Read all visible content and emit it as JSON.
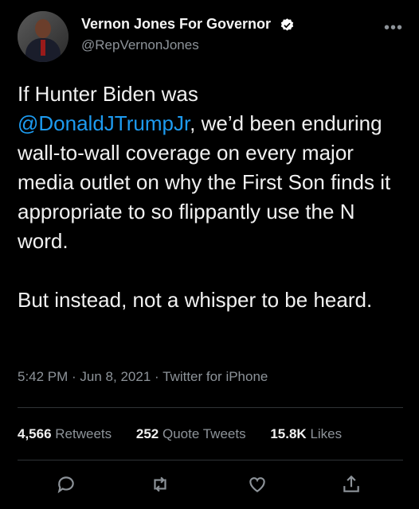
{
  "account": {
    "name": "Vernon Jones For Governor",
    "handle": "@RepVernonJones"
  },
  "more_label": "•••",
  "tweet": {
    "line1": "If Hunter Biden was",
    "mention": "@DonaldJTrumpJr",
    "after_mention": ", we’d been",
    "rest": "enduring wall-to-wall coverage on every major media outlet on why the First Son finds it appropriate to so flippantly use the N word.",
    "para2": "But instead, not a whisper to be heard."
  },
  "meta": {
    "time": "5:42 PM",
    "sep1": " · ",
    "date": "Jun 8, 2021",
    "sep2": " · ",
    "client": "Twitter for iPhone"
  },
  "stats": {
    "retweets_count": "4,566",
    "retweets_label": "Retweets",
    "quotes_count": "252",
    "quotes_label": "Quote Tweets",
    "likes_count": "15.8K",
    "likes_label": "Likes"
  },
  "colors": {
    "background": "#000000",
    "text": "#f1f1f1",
    "secondary": "#8d9399",
    "link": "#1d9bf0",
    "verified": "#ffffff"
  },
  "icons": [
    "reply-icon",
    "retweet-icon",
    "like-icon",
    "share-icon"
  ]
}
